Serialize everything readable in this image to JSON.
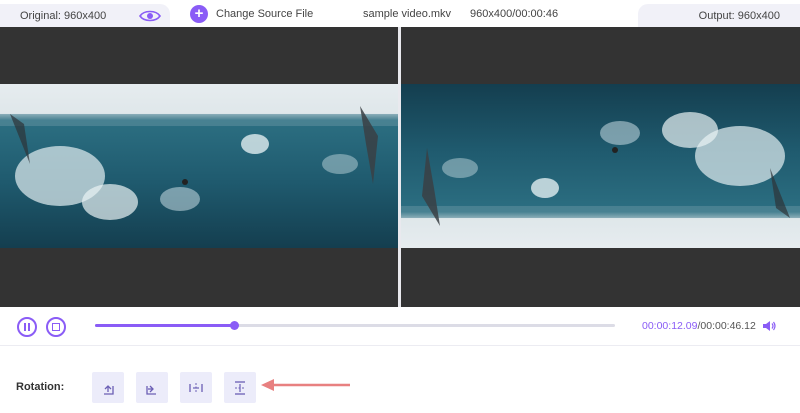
{
  "header": {
    "original_label": "Original: 960x400",
    "change_source_label": "Change Source File",
    "file_name": "sample video.mkv",
    "file_info": "960x400/00:00:46",
    "output_label": "Output: 960x400"
  },
  "icons": {
    "preview_toggle": "eye-icon",
    "change_source": "plus-circle-icon",
    "pause": "pause-icon",
    "stop": "stop-icon",
    "volume": "speaker-icon",
    "rotate_left": "rotate-left-icon",
    "rotate_right": "rotate-right-icon",
    "flip_horizontal": "flip-horizontal-icon",
    "flip_vertical": "flip-vertical-icon",
    "annotation": "red-arrow-pointing-left"
  },
  "playback": {
    "current_time": "00:00:12.09",
    "separator": "/",
    "total_time": "00:00:46.12",
    "progress": 0.268
  },
  "rotation": {
    "label": "Rotation:",
    "buttons": [
      "rotate-left",
      "rotate-right",
      "flip-horizontal",
      "flip-vertical"
    ]
  },
  "colors": {
    "accent": "#8a5cf6",
    "preview_background": "#333333",
    "tab_background": "#f1f1f8",
    "rotation_button_background": "#ececfa",
    "annotation_arrow": "#e88080"
  }
}
